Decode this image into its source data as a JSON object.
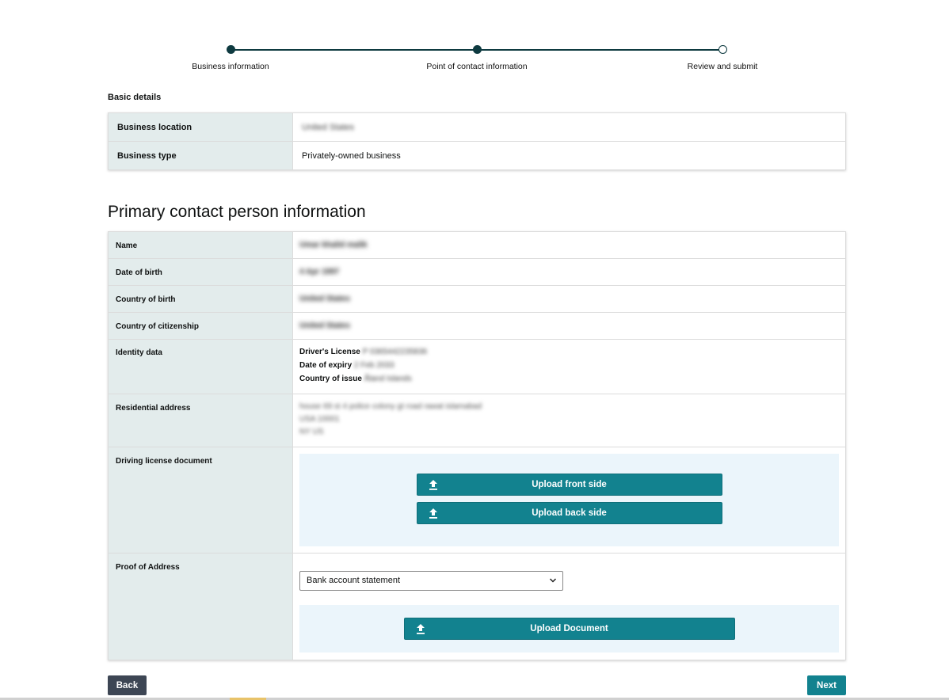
{
  "stepper": {
    "steps": [
      {
        "label": "Business information",
        "state": "complete"
      },
      {
        "label": "Point of contact information",
        "state": "current"
      },
      {
        "label": "Review and submit",
        "state": "pending"
      }
    ]
  },
  "basic_details": {
    "title": "Basic details",
    "rows": [
      {
        "label": "Business location",
        "value": "United States"
      },
      {
        "label": "Business type",
        "value": "Privately-owned business"
      }
    ]
  },
  "primary_contact": {
    "heading": "Primary contact person information",
    "name": {
      "label": "Name",
      "value": "Umar khalid malik"
    },
    "dob": {
      "label": "Date of birth",
      "value": "4 Apr 1997"
    },
    "country_of_birth": {
      "label": "Country of birth",
      "value": "United States"
    },
    "citizenship": {
      "label": "Country of citizenship",
      "value": "United States"
    },
    "identity": {
      "label": "Identity data",
      "license_label": "Driver's License",
      "license_value": "P 0365442235836",
      "expiry_label": "Date of expiry",
      "expiry_value": "2 Feb 2033",
      "issue_label": "Country of issue",
      "issue_value": "Åland Islands"
    },
    "address": {
      "label": "Residential address",
      "line1": "house 69 st 4 police colony gt road rawat islamabad",
      "line2": "USA 10001",
      "line3": "NY US"
    },
    "driving_license": {
      "label": "Driving license document",
      "front_button": "Upload front side",
      "back_button": "Upload back side"
    },
    "proof_of_address": {
      "label": "Proof of Address",
      "selected": "Bank account statement",
      "upload_button": "Upload Document"
    }
  },
  "footer": {
    "back": "Back",
    "next": "Next"
  },
  "colors": {
    "accent": "#12828f",
    "stepper": "#0e3a40",
    "label_bg": "#e3ecec",
    "upload_panel": "#ebf5fb",
    "back_button": "#3d4654"
  }
}
